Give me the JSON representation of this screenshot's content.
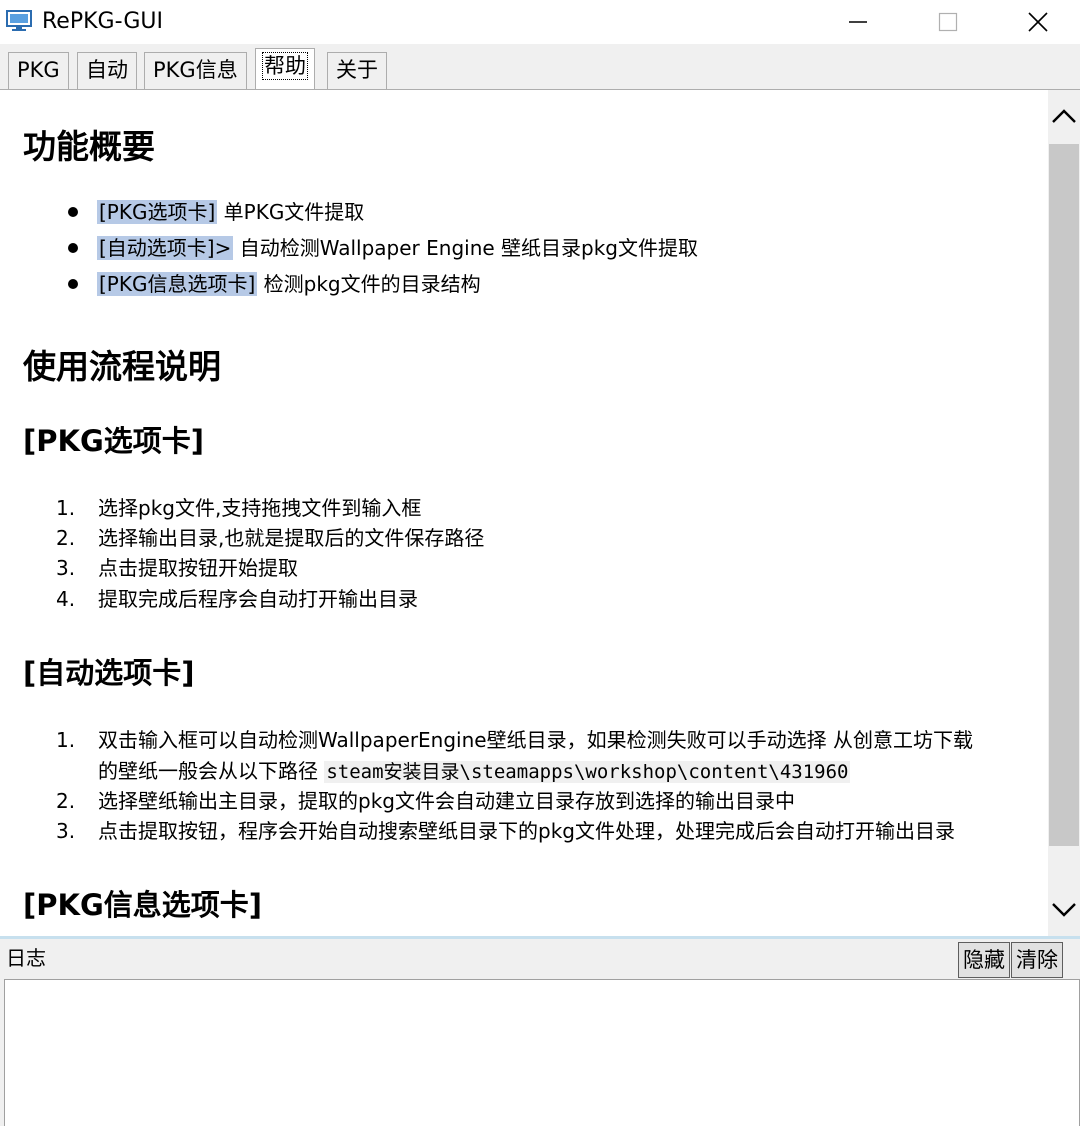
{
  "window": {
    "title": "RePKG-GUI",
    "icons": {
      "app": "monitor-icon",
      "minimize": "minimize-icon",
      "maximize": "maximize-icon",
      "close": "close-icon"
    }
  },
  "tabs": [
    {
      "label": "PKG",
      "active": false
    },
    {
      "label": "自动",
      "active": false
    },
    {
      "label": "PKG信息",
      "active": false
    },
    {
      "label": "帮助",
      "active": true
    },
    {
      "label": "关于",
      "active": false
    }
  ],
  "help": {
    "overview_title": "功能概要",
    "overview_items": [
      {
        "tag": "[PKG选项卡]",
        "text": " 单PKG文件提取"
      },
      {
        "tag": "[自动选项卡]>",
        "text": " 自动检测Wallpaper Engine 壁纸目录pkg文件提取"
      },
      {
        "tag": "[PKG信息选项卡]",
        "text": " 检测pkg文件的目录结构"
      }
    ],
    "usage_title": "使用流程说明",
    "pkg_section": {
      "title": "[PKG选项卡]",
      "steps": [
        {
          "num": "1.",
          "text": "选择pkg文件,支持拖拽文件到输入框"
        },
        {
          "num": "2.",
          "text": "选择输出目录,也就是提取后的文件保存路径"
        },
        {
          "num": "3.",
          "text": "点击提取按钮开始提取"
        },
        {
          "num": "4.",
          "text": "提取完成后程序会自动打开输出目录"
        }
      ]
    },
    "auto_section": {
      "title": "[自动选项卡]",
      "step1_num": "1.",
      "step1_line1": "双击输入框可以自动检测WallpaperEngine壁纸目录，如果检测失败可以手动选择 从创意工坊下载",
      "step1_line2": "的壁纸一般会从以下路径 ",
      "step1_code": "steam安装目录\\steamapps\\workshop\\content\\431960",
      "step2_num": "2.",
      "step2_text": "选择壁纸输出主目录，提取的pkg文件会自动建立目录存放到选择的输出目录中",
      "step3_num": "3.",
      "step3_text": "点击提取按钮，程序会开始自动搜索壁纸目录下的pkg文件处理，处理完成后会自动打开输出目录"
    },
    "info_section": {
      "title": "[PKG信息选项卡]"
    }
  },
  "log": {
    "label": "日志",
    "hide_button": "隐藏",
    "clear_button": "清除",
    "content": ""
  }
}
